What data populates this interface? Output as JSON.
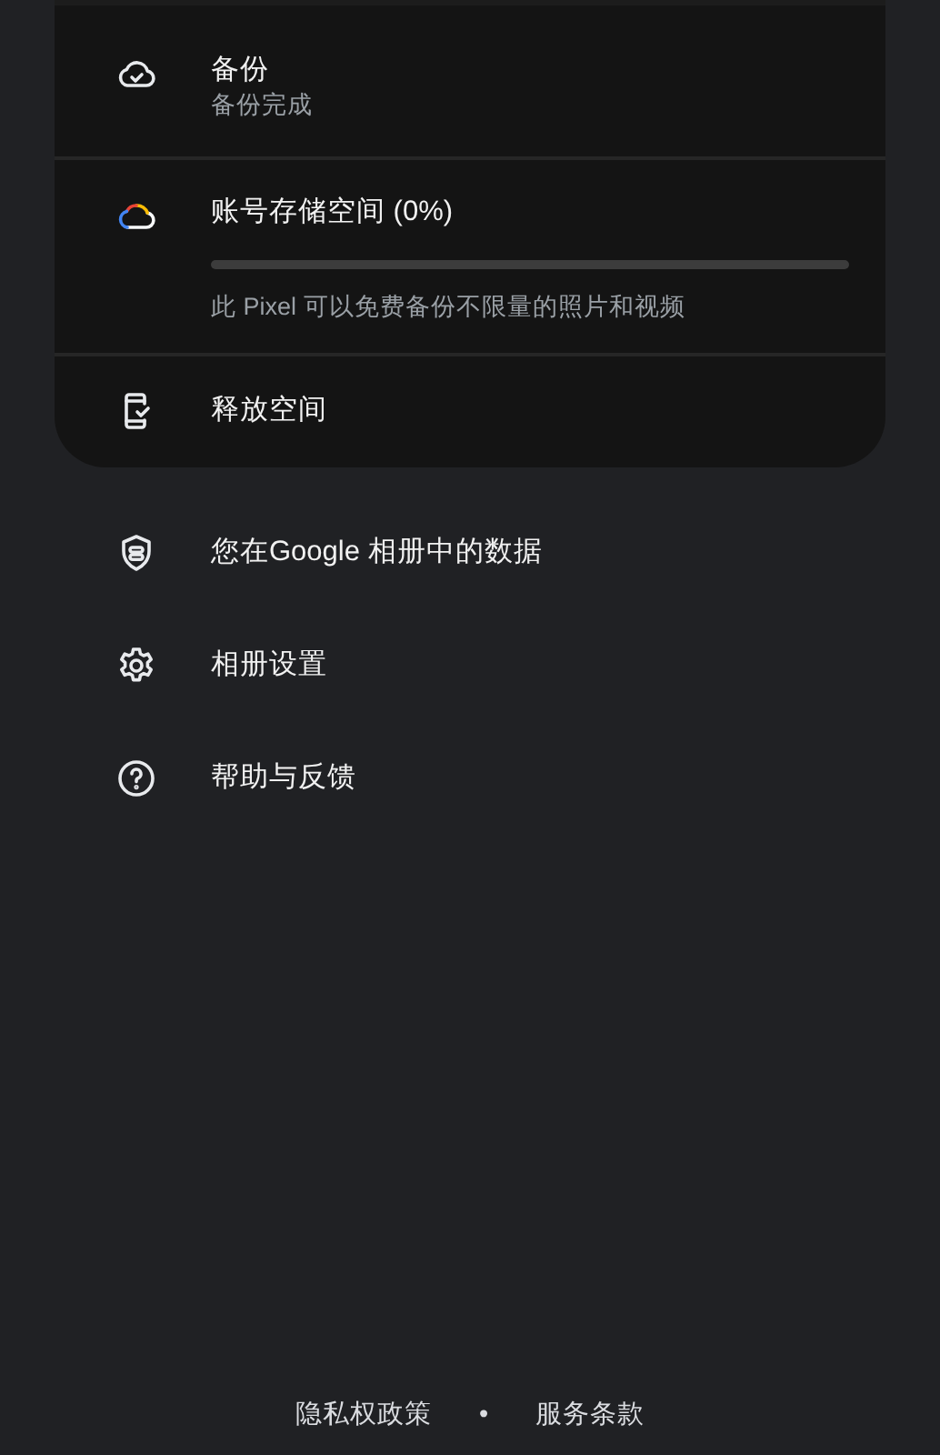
{
  "card_items": [
    {
      "kind": "backup",
      "title": "备份",
      "subtitle": "备份完成"
    },
    {
      "kind": "storage",
      "title": "账号存储空间 (0%)",
      "level": 0,
      "note": "此 Pixel 可以免费备份不限量的照片和视频"
    },
    {
      "kind": "free_up",
      "title": "释放空间"
    }
  ],
  "menu_items": [
    {
      "kind": "data",
      "label": "您在Google 相册中的数据"
    },
    {
      "kind": "settings",
      "label": "相册设置"
    },
    {
      "kind": "help",
      "label": "帮助与反馈"
    }
  ],
  "footer": {
    "links": [
      "隐私权政策",
      "服务条款"
    ],
    "separator": "•"
  }
}
